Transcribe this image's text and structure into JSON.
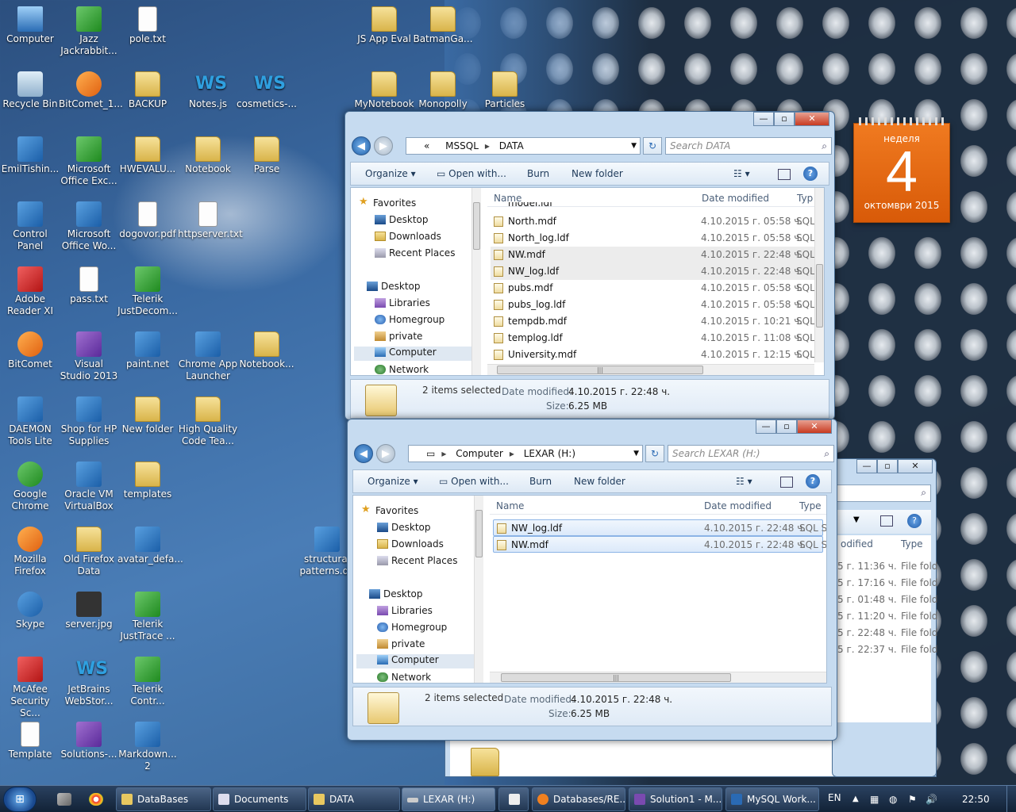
{
  "desktop": {
    "icons": [
      {
        "label": "Computer"
      },
      {
        "label": "Jazz Jackrabbit..."
      },
      {
        "label": "pole.txt"
      },
      {
        "label": "Recycle Bin"
      },
      {
        "label": "BitComet_1..."
      },
      {
        "label": "BACKUP"
      },
      {
        "label": "Notes.js"
      },
      {
        "label": "cosmetics-..."
      },
      {
        "label": "EmilTishin..."
      },
      {
        "label": "Microsoft Office Exc..."
      },
      {
        "label": "HWEVALU..."
      },
      {
        "label": "Notebook"
      },
      {
        "label": "Parse"
      },
      {
        "label": "Control Panel"
      },
      {
        "label": "Microsoft Office Wo..."
      },
      {
        "label": "dogovor.pdf"
      },
      {
        "label": "httpserver.txt"
      },
      {
        "label": "Adobe Reader XI"
      },
      {
        "label": "pass.txt"
      },
      {
        "label": "Telerik JustDecom..."
      },
      {
        "label": "BitComet"
      },
      {
        "label": "Visual Studio 2013"
      },
      {
        "label": "paint.net"
      },
      {
        "label": "Chrome App Launcher"
      },
      {
        "label": "Notebook..."
      },
      {
        "label": "DAEMON Tools Lite"
      },
      {
        "label": "Shop for HP Supplies"
      },
      {
        "label": "New folder"
      },
      {
        "label": "High Quality Code Tea..."
      },
      {
        "label": "Google Chrome"
      },
      {
        "label": "Oracle VM VirtualBox"
      },
      {
        "label": "templates"
      },
      {
        "label": "Mozilla Firefox"
      },
      {
        "label": "Old Firefox Data"
      },
      {
        "label": "avatar_defa..."
      },
      {
        "label": "Skype"
      },
      {
        "label": "server.jpg"
      },
      {
        "label": "Telerik JustTrace ..."
      },
      {
        "label": "McAfee Security Sc..."
      },
      {
        "label": "JetBrains WebStor..."
      },
      {
        "label": "Telerik Contr..."
      },
      {
        "label": "Template"
      },
      {
        "label": "Solutions-..."
      },
      {
        "label": "Markdown... 2"
      },
      {
        "label": "JS App Eval"
      },
      {
        "label": "BatmanGa..."
      },
      {
        "label": "MyNotebook"
      },
      {
        "label": "Monopolly"
      },
      {
        "label": "Particles"
      },
      {
        "label": "structural patterns.do"
      }
    ]
  },
  "calendar": {
    "weekday": "неделя",
    "day": "4",
    "month_year": "октомври 2015"
  },
  "window_data": {
    "address": {
      "prefix": "«",
      "parts": [
        "MSSQL",
        "DATA"
      ]
    },
    "search_placeholder": "Search DATA",
    "toolbar": {
      "organize": "Organize",
      "open_with": "Open with...",
      "burn": "Burn",
      "new_folder": "New folder",
      "help": "?"
    },
    "nav": {
      "favorites": "Favorites",
      "desktop_fav": "Desktop",
      "downloads": "Downloads",
      "recent": "Recent Places",
      "desktop": "Desktop",
      "libraries": "Libraries",
      "homegroup": "Homegroup",
      "private": "private",
      "computer": "Computer",
      "network": "Network"
    },
    "columns": {
      "name": "Name",
      "date": "Date modified",
      "type": "Typ"
    },
    "partial_row": "model.ldf",
    "files": [
      {
        "name": "North.mdf",
        "date": "4.10.2015 г. 05:58 ч.",
        "type": "SQL"
      },
      {
        "name": "North_log.ldf",
        "date": "4.10.2015 г. 05:58 ч.",
        "type": "SQL"
      },
      {
        "name": "NW.mdf",
        "date": "4.10.2015 г. 22:48 ч.",
        "type": "SQL"
      },
      {
        "name": "NW_log.ldf",
        "date": "4.10.2015 г. 22:48 ч.",
        "type": "SQL"
      },
      {
        "name": "pubs.mdf",
        "date": "4.10.2015 г. 05:58 ч.",
        "type": "SQL"
      },
      {
        "name": "pubs_log.ldf",
        "date": "4.10.2015 г. 05:58 ч.",
        "type": "SQL"
      },
      {
        "name": "tempdb.mdf",
        "date": "4.10.2015 г. 10:21 ч.",
        "type": "SQL"
      },
      {
        "name": "templog.ldf",
        "date": "4.10.2015 г. 11:08 ч.",
        "type": "SQL"
      },
      {
        "name": "University.mdf",
        "date": "4.10.2015 г. 12:15 ч.",
        "type": "SQL"
      }
    ],
    "details": {
      "selected": "2 items selected",
      "date_label": "Date modified:",
      "date_value": "4.10.2015 г. 22:48 ч.",
      "size_label": "Size:",
      "size_value": "6.25 MB"
    }
  },
  "window_lexar": {
    "address": {
      "parts": [
        "Computer",
        "LEXAR (H:)"
      ]
    },
    "search_placeholder": "Search LEXAR (H:)",
    "toolbar": {
      "organize": "Organize",
      "open_with": "Open with...",
      "burn": "Burn",
      "new_folder": "New folder",
      "help": "?"
    },
    "nav": {
      "favorites": "Favorites",
      "desktop_fav": "Desktop",
      "downloads": "Downloads",
      "recent": "Recent Places",
      "desktop": "Desktop",
      "libraries": "Libraries",
      "homegroup": "Homegroup",
      "private": "private",
      "computer": "Computer",
      "network": "Network"
    },
    "columns": {
      "name": "Name",
      "date": "Date modified",
      "type": "Type"
    },
    "files": [
      {
        "name": "NW_log.ldf",
        "date": "4.10.2015 г. 22:48 ч.",
        "type": "SQL Ser"
      },
      {
        "name": "NW.mdf",
        "date": "4.10.2015 г. 22:48 ч.",
        "type": "SQL Ser"
      }
    ],
    "details": {
      "selected": "2 items selected",
      "date_label": "Date modified:",
      "date_value": "4.10.2015 г. 22:48 ч.",
      "size_label": "Size:",
      "size_value": "6.25 MB"
    }
  },
  "window_back": {
    "col_date": "odified",
    "col_type": "Type",
    "rows": [
      {
        "date": "5 г. 11:36 ч.",
        "type": "File fold"
      },
      {
        "date": "5 г. 17:16 ч.",
        "type": "File fold"
      },
      {
        "date": "5 г. 01:48 ч.",
        "type": "File fold"
      },
      {
        "date": "5 г. 11:20 ч.",
        "type": "File fold"
      },
      {
        "date": "5 г. 22:48 ч.",
        "type": "File fold"
      },
      {
        "date": "5 г. 22:37 ч.",
        "type": "File fold"
      }
    ]
  },
  "taskbar": {
    "tasks": [
      {
        "label": "DataBases"
      },
      {
        "label": "Documents"
      },
      {
        "label": "DATA"
      },
      {
        "label": "LEXAR (H:)"
      },
      {
        "label": ""
      },
      {
        "label": "Databases/RE..."
      },
      {
        "label": "Solution1 - M..."
      },
      {
        "label": "MySQL Work..."
      }
    ],
    "lang": "EN",
    "time": "22:50"
  },
  "colors": {
    "accent": "#1e5aa8",
    "calendar": "#e86a12",
    "selection": "#dbe9fa"
  }
}
